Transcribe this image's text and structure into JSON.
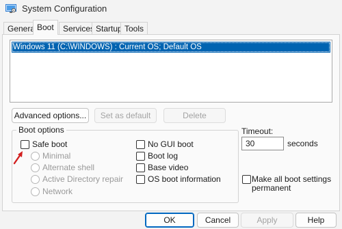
{
  "window": {
    "title": "System Configuration",
    "app_icon": "msconfig-icon"
  },
  "tabs": [
    {
      "label": "General",
      "active": false
    },
    {
      "label": "Boot",
      "active": true
    },
    {
      "label": "Services",
      "active": false
    },
    {
      "label": "Startup",
      "active": false
    },
    {
      "label": "Tools",
      "active": false
    }
  ],
  "os_list": {
    "items": [
      {
        "label": "Windows 11 (C:\\WINDOWS) : Current OS; Default OS",
        "selected": true
      }
    ]
  },
  "list_buttons": {
    "advanced": "Advanced options...",
    "set_default": "Set as default",
    "delete": "Delete"
  },
  "boot_options": {
    "group_label": "Boot options",
    "safe_boot": {
      "label": "Safe boot",
      "checked": false
    },
    "safe_boot_modes": [
      {
        "label": "Minimal"
      },
      {
        "label": "Alternate shell"
      },
      {
        "label": "Active Directory repair"
      },
      {
        "label": "Network"
      }
    ],
    "right_options": [
      {
        "label": "No GUI boot",
        "checked": false
      },
      {
        "label": "Boot log",
        "checked": false
      },
      {
        "label": "Base video",
        "checked": false
      },
      {
        "label": "OS boot information",
        "checked": false
      }
    ]
  },
  "timeout": {
    "label": "Timeout:",
    "value": "30",
    "unit": "seconds"
  },
  "permanent": {
    "label_line1": "Make all boot settings",
    "label_line2": "permanent",
    "checked": false
  },
  "dialog_buttons": {
    "ok": "OK",
    "cancel": "Cancel",
    "apply": "Apply",
    "help": "Help"
  },
  "colors": {
    "selection": "#0063b1",
    "accent_border": "#0067c0",
    "annotation_arrow": "#d21f1f"
  }
}
